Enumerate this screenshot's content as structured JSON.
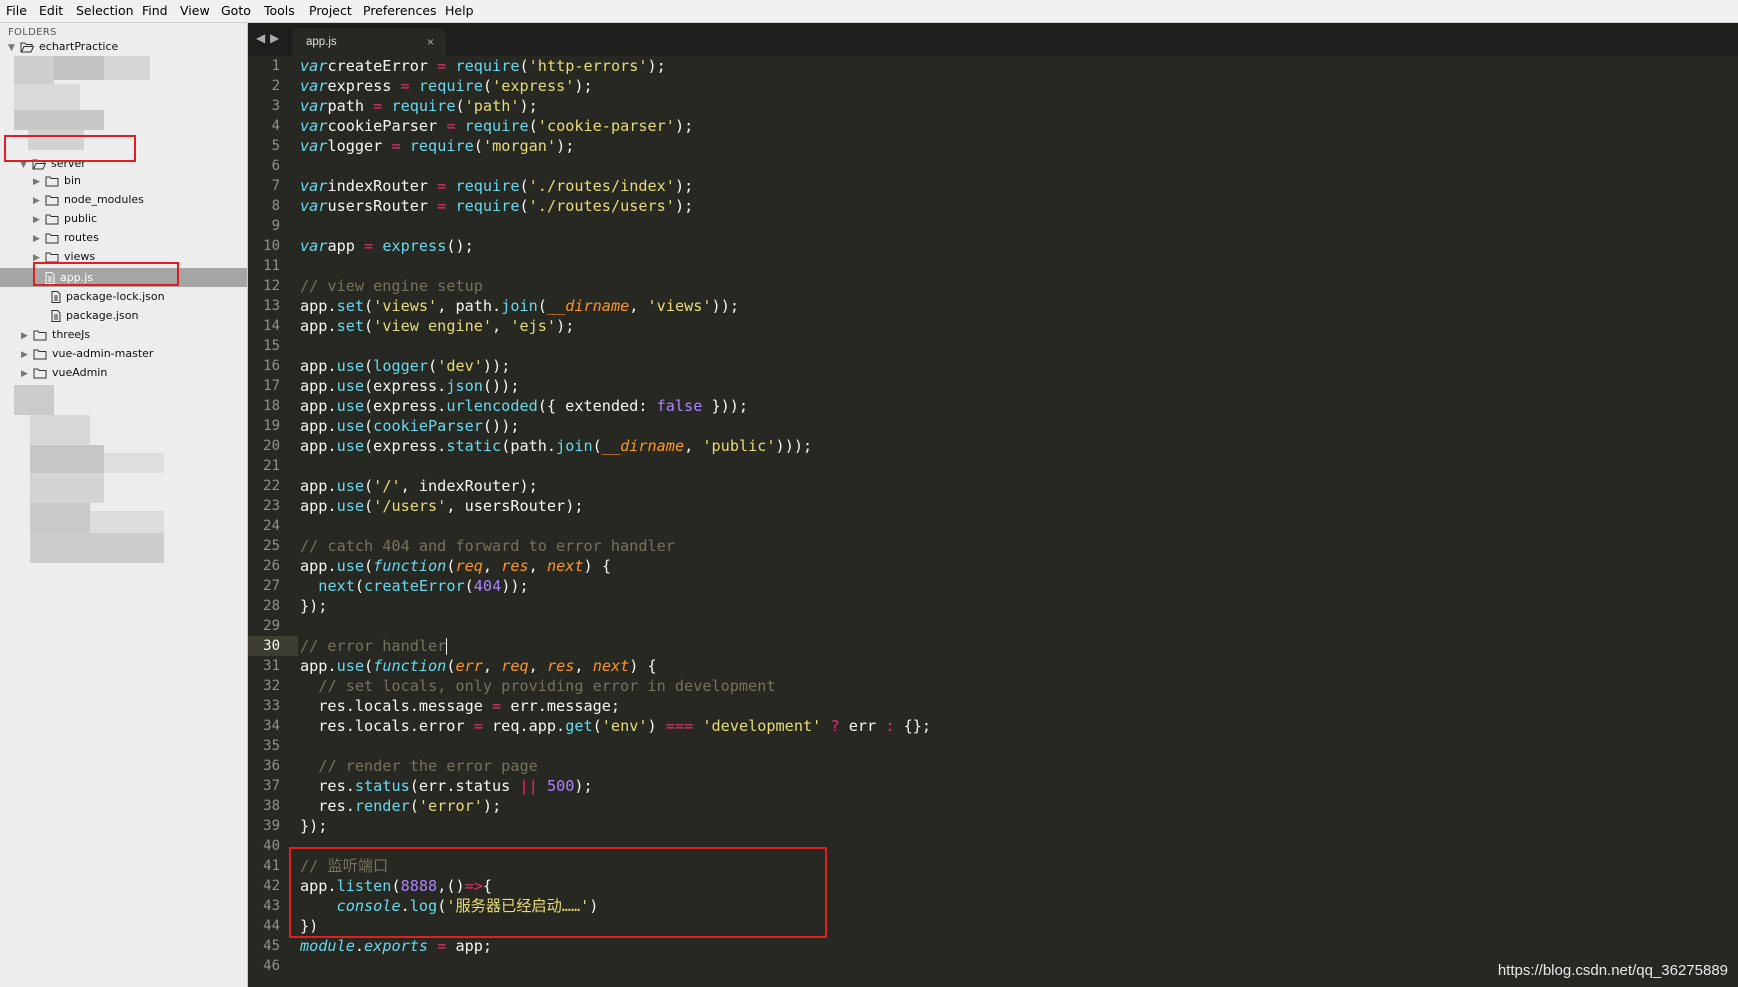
{
  "menu": [
    "File",
    "Edit",
    "Selection",
    "Find",
    "View",
    "Goto",
    "Tools",
    "Project",
    "Preferences",
    "Help"
  ],
  "sidebar": {
    "header": "FOLDERS",
    "root": "echartPractice",
    "server": "server",
    "server_children": [
      "bin",
      "node_modules",
      "public",
      "routes",
      "views"
    ],
    "selected_file": "app.js",
    "files": [
      "package-lock.json",
      "package.json"
    ],
    "other_folders": [
      "threeJs",
      "vue-admin-master",
      "vueAdmin"
    ]
  },
  "tab": {
    "name": "app.js",
    "close": "×"
  },
  "nav": {
    "back": "◀",
    "forward": "▶"
  },
  "editor": {
    "current_line": 30,
    "lines": [
      [
        [
          "kw",
          "var"
        ],
        [
          "",
          "createError "
        ],
        [
          "op",
          "="
        ],
        [
          "",
          " "
        ],
        [
          "fn",
          "require"
        ],
        [
          "",
          "("
        ],
        [
          "st",
          "'http-errors'"
        ],
        [
          "",
          ");"
        ]
      ],
      [
        [
          "kw",
          "var"
        ],
        [
          "",
          "express "
        ],
        [
          "op",
          "="
        ],
        [
          "",
          " "
        ],
        [
          "fn",
          "require"
        ],
        [
          "",
          "("
        ],
        [
          "st",
          "'express'"
        ],
        [
          "",
          ");"
        ]
      ],
      [
        [
          "kw",
          "var"
        ],
        [
          "",
          "path "
        ],
        [
          "op",
          "="
        ],
        [
          "",
          " "
        ],
        [
          "fn",
          "require"
        ],
        [
          "",
          "("
        ],
        [
          "st",
          "'path'"
        ],
        [
          "",
          ");"
        ]
      ],
      [
        [
          "kw",
          "var"
        ],
        [
          "",
          "cookieParser "
        ],
        [
          "op",
          "="
        ],
        [
          "",
          " "
        ],
        [
          "fn",
          "require"
        ],
        [
          "",
          "("
        ],
        [
          "st",
          "'cookie-parser'"
        ],
        [
          "",
          ");"
        ]
      ],
      [
        [
          "kw",
          "var"
        ],
        [
          "",
          "logger "
        ],
        [
          "op",
          "="
        ],
        [
          "",
          " "
        ],
        [
          "fn",
          "require"
        ],
        [
          "",
          "("
        ],
        [
          "st",
          "'morgan'"
        ],
        [
          "",
          ");"
        ]
      ],
      [],
      [
        [
          "kw",
          "var"
        ],
        [
          "",
          "indexRouter "
        ],
        [
          "op",
          "="
        ],
        [
          "",
          " "
        ],
        [
          "fn",
          "require"
        ],
        [
          "",
          "("
        ],
        [
          "st",
          "'./routes/index'"
        ],
        [
          "",
          ");"
        ]
      ],
      [
        [
          "kw",
          "var"
        ],
        [
          "",
          "usersRouter "
        ],
        [
          "op",
          "="
        ],
        [
          "",
          " "
        ],
        [
          "fn",
          "require"
        ],
        [
          "",
          "("
        ],
        [
          "st",
          "'./routes/users'"
        ],
        [
          "",
          ");"
        ]
      ],
      [],
      [
        [
          "kw",
          "var"
        ],
        [
          "",
          "app "
        ],
        [
          "op",
          "="
        ],
        [
          "",
          " "
        ],
        [
          "fn",
          "express"
        ],
        [
          "",
          "();"
        ]
      ],
      [],
      [
        [
          "cm",
          "// view engine setup"
        ]
      ],
      [
        [
          "",
          "app."
        ],
        [
          "fn",
          "set"
        ],
        [
          "",
          "("
        ],
        [
          "st",
          "'views'"
        ],
        [
          "",
          ", path."
        ],
        [
          "fn",
          "join"
        ],
        [
          "",
          "("
        ],
        [
          "pa",
          "__dirname"
        ],
        [
          "",
          ", "
        ],
        [
          "st",
          "'views'"
        ],
        [
          "",
          "));"
        ]
      ],
      [
        [
          "",
          "app."
        ],
        [
          "fn",
          "set"
        ],
        [
          "",
          "("
        ],
        [
          "st",
          "'view engine'"
        ],
        [
          "",
          ", "
        ],
        [
          "st",
          "'ejs'"
        ],
        [
          "",
          ");"
        ]
      ],
      [],
      [
        [
          "",
          "app."
        ],
        [
          "fn",
          "use"
        ],
        [
          "",
          "("
        ],
        [
          "fn",
          "logger"
        ],
        [
          "",
          "("
        ],
        [
          "st",
          "'dev'"
        ],
        [
          "",
          "));"
        ]
      ],
      [
        [
          "",
          "app."
        ],
        [
          "fn",
          "use"
        ],
        [
          "",
          "(express."
        ],
        [
          "fn",
          "json"
        ],
        [
          "",
          "());"
        ]
      ],
      [
        [
          "",
          "app."
        ],
        [
          "fn",
          "use"
        ],
        [
          "",
          "(express."
        ],
        [
          "fn",
          "urlencoded"
        ],
        [
          "",
          "({ extended: "
        ],
        [
          "nm",
          "false"
        ],
        [
          "",
          " }));"
        ]
      ],
      [
        [
          "",
          "app."
        ],
        [
          "fn",
          "use"
        ],
        [
          "",
          "("
        ],
        [
          "fn",
          "cookieParser"
        ],
        [
          "",
          "());"
        ]
      ],
      [
        [
          "",
          "app."
        ],
        [
          "fn",
          "use"
        ],
        [
          "",
          "(express."
        ],
        [
          "fn",
          "static"
        ],
        [
          "",
          "(path."
        ],
        [
          "fn",
          "join"
        ],
        [
          "",
          "("
        ],
        [
          "pa",
          "__dirname"
        ],
        [
          "",
          ", "
        ],
        [
          "st",
          "'public'"
        ],
        [
          "",
          ")));"
        ]
      ],
      [],
      [
        [
          "",
          "app."
        ],
        [
          "fn",
          "use"
        ],
        [
          "",
          "("
        ],
        [
          "st",
          "'/'"
        ],
        [
          "",
          ", indexRouter);"
        ]
      ],
      [
        [
          "",
          "app."
        ],
        [
          "fn",
          "use"
        ],
        [
          "",
          "("
        ],
        [
          "st",
          "'/users'"
        ],
        [
          "",
          ", usersRouter);"
        ]
      ],
      [],
      [
        [
          "cm",
          "// catch 404 and forward to error handler"
        ]
      ],
      [
        [
          "",
          "app."
        ],
        [
          "fn",
          "use"
        ],
        [
          "",
          "("
        ],
        [
          "kw",
          "function"
        ],
        [
          "",
          "("
        ],
        [
          "pa",
          "req"
        ],
        [
          "",
          ", "
        ],
        [
          "pa",
          "res"
        ],
        [
          "",
          ", "
        ],
        [
          "pa",
          "next"
        ],
        [
          "",
          ") {"
        ]
      ],
      [
        [
          "",
          "  "
        ],
        [
          "fn",
          "next"
        ],
        [
          "",
          "("
        ],
        [
          "fn",
          "createError"
        ],
        [
          "",
          "("
        ],
        [
          "nm",
          "404"
        ],
        [
          "",
          "));"
        ]
      ],
      [
        [
          "",
          "});"
        ]
      ],
      [],
      [
        [
          "cm",
          "// error handler"
        ],
        [
          "cursor",
          ""
        ]
      ],
      [
        [
          "",
          "app."
        ],
        [
          "fn",
          "use"
        ],
        [
          "",
          "("
        ],
        [
          "kw",
          "function"
        ],
        [
          "",
          "("
        ],
        [
          "pa",
          "err"
        ],
        [
          "",
          ", "
        ],
        [
          "pa",
          "req"
        ],
        [
          "",
          ", "
        ],
        [
          "pa",
          "res"
        ],
        [
          "",
          ", "
        ],
        [
          "pa",
          "next"
        ],
        [
          "",
          ") {"
        ]
      ],
      [
        [
          "",
          "  "
        ],
        [
          "cm",
          "// set locals, only providing error in development"
        ]
      ],
      [
        [
          "",
          "  res.locals.message "
        ],
        [
          "op",
          "="
        ],
        [
          "",
          " err.message;"
        ]
      ],
      [
        [
          "",
          "  res.locals.error "
        ],
        [
          "op",
          "="
        ],
        [
          "",
          " req.app."
        ],
        [
          "fn",
          "get"
        ],
        [
          "",
          "("
        ],
        [
          "st",
          "'env'"
        ],
        [
          "",
          ") "
        ],
        [
          "op",
          "==="
        ],
        [
          "",
          " "
        ],
        [
          "st",
          "'development'"
        ],
        [
          "",
          " "
        ],
        [
          "op",
          "?"
        ],
        [
          "",
          " err "
        ],
        [
          "op",
          ":"
        ],
        [
          "",
          " {};"
        ]
      ],
      [],
      [
        [
          "",
          "  "
        ],
        [
          "cm",
          "// render the error page"
        ]
      ],
      [
        [
          "",
          "  res."
        ],
        [
          "fn",
          "status"
        ],
        [
          "",
          "(err.status "
        ],
        [
          "op",
          "||"
        ],
        [
          "",
          " "
        ],
        [
          "nm",
          "500"
        ],
        [
          "",
          ");"
        ]
      ],
      [
        [
          "",
          "  res."
        ],
        [
          "fn",
          "render"
        ],
        [
          "",
          "("
        ],
        [
          "st",
          "'error'"
        ],
        [
          "",
          ");"
        ]
      ],
      [
        [
          "",
          "});"
        ]
      ],
      [],
      [
        [
          "cm",
          "// 监听端口"
        ]
      ],
      [
        [
          "",
          "app."
        ],
        [
          "fn",
          "listen"
        ],
        [
          "",
          "("
        ],
        [
          "nm",
          "8888"
        ],
        [
          "",
          ",()"
        ],
        [
          "op",
          "=>"
        ],
        [
          "",
          "{"
        ]
      ],
      [
        [
          "",
          "    "
        ],
        [
          "kw",
          "console"
        ],
        [
          "",
          "."
        ],
        [
          "fn",
          "log"
        ],
        [
          "",
          "("
        ],
        [
          "st",
          "'服务器已经启动……'"
        ],
        [
          "",
          ")"
        ]
      ],
      [
        [
          "",
          "})"
        ]
      ],
      [
        [
          "kw",
          "module"
        ],
        [
          "",
          "."
        ],
        [
          "kw",
          "exports"
        ],
        [
          "",
          " "
        ],
        [
          "op",
          "="
        ],
        [
          "",
          " app;"
        ]
      ],
      []
    ]
  },
  "watermark": "https://blog.csdn.net/qq_36275889"
}
